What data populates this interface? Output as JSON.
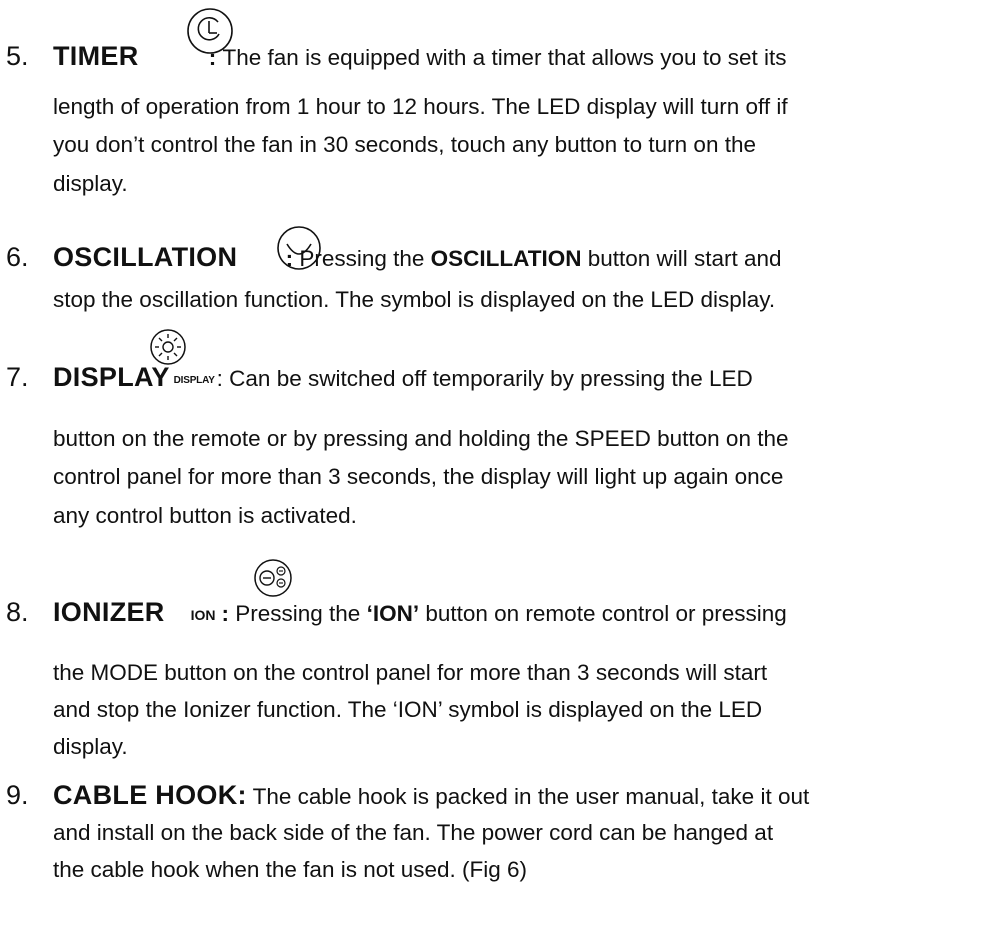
{
  "items": [
    {
      "number": "5.",
      "title": "TIMER",
      "icon": "clock-circle-icon",
      "lines": [
        [
          ": ",
          "The fan is equipped with a timer that allows you to set its"
        ],
        "length of operation from 1 hour to 12 hours. The LED display will turn off if",
        "you don’t control the fan in 30 seconds, touch any button to turn on the",
        "display."
      ]
    },
    {
      "number": "6.",
      "title": "OSCILLATION",
      "icon": "oscillation-circle-icon",
      "line1_a": ": ",
      "line1_b": "Pressing the ",
      "line1_bold": "OSCILLATION",
      "line1_c": " button will start and",
      "line2": "stop the oscillation function. The symbol is displayed on the LED display."
    },
    {
      "number": "7.",
      "title": "DISPLAY",
      "icon": "sun-circle-icon",
      "icon_label": "DISPLAY",
      "line1": ": Can be switched off temporarily by pressing the LED",
      "line2": "button on the remote or by pressing and holding the SPEED button on the",
      "line3": "control panel for more than 3 seconds, the display will light up again once",
      "line4": "any control button is activated."
    },
    {
      "number": "8.",
      "title": "IONIZER",
      "icon": "ion-circle-icon",
      "icon_label": "ION",
      "line1_a": ": ",
      "line1_b": "Pressing the ",
      "line1_bold": "‘ION’",
      "line1_c": " button on remote control or pressing",
      "line2": "the MODE button on the control panel for more than 3 seconds will start",
      "line3": "and stop the Ionizer function. The ‘ION’ symbol is displayed on the LED",
      "line4": "display."
    },
    {
      "number": "9.",
      "title": "CABLE HOOK:",
      "line1": " The cable hook is packed in the user manual, take it out",
      "line2": "and install on the back side of the fan. The power cord can be hanged at",
      "line3": "the cable hook when the fan is not used. (Fig 6)"
    }
  ]
}
